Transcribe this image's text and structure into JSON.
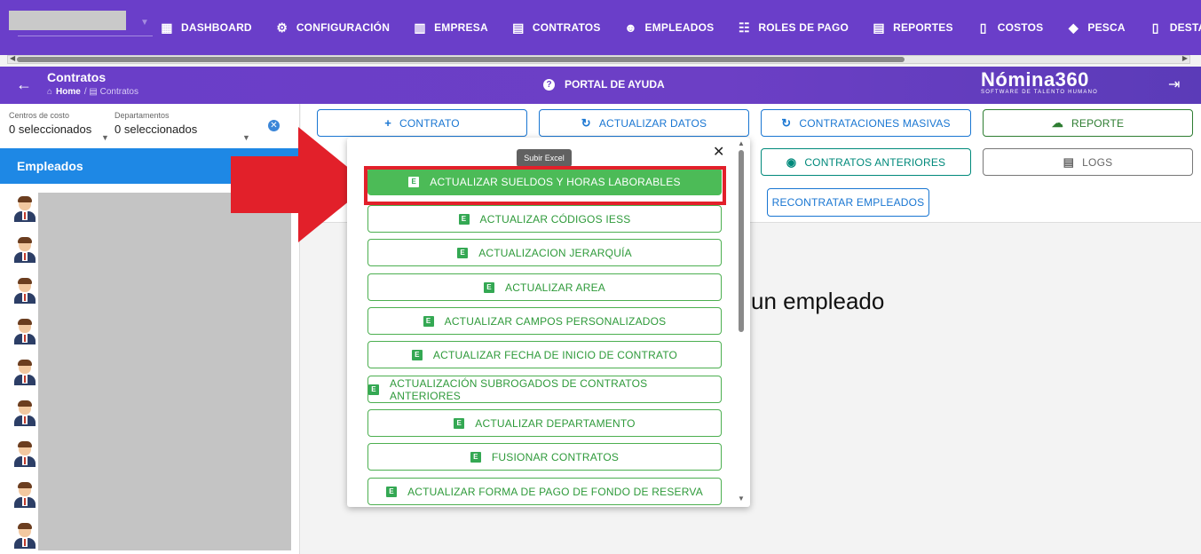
{
  "topnav": {
    "items": [
      {
        "label": "DASHBOARD",
        "icon": "dashboard-icon",
        "glyph": "▦"
      },
      {
        "label": "CONFIGURACIÓN",
        "icon": "gear-icon",
        "glyph": "⚙"
      },
      {
        "label": "EMPRESA",
        "icon": "building-icon",
        "glyph": "▥"
      },
      {
        "label": "CONTRATOS",
        "icon": "clipboard-icon",
        "glyph": "▤"
      },
      {
        "label": "EMPLEADOS",
        "icon": "face-icon",
        "glyph": "☻"
      },
      {
        "label": "ROLES DE PAGO",
        "icon": "group-icon",
        "glyph": "☷"
      },
      {
        "label": "REPORTES",
        "icon": "report-icon",
        "glyph": "▤"
      },
      {
        "label": "COSTOS",
        "icon": "cost-file-icon",
        "glyph": "▯"
      },
      {
        "label": "PESCA",
        "icon": "fish-icon",
        "glyph": "◆"
      },
      {
        "label": "DESTAJO",
        "icon": "document-icon",
        "glyph": "▯"
      }
    ]
  },
  "header": {
    "title": "Contratos",
    "breadcrumb_home": "Home",
    "breadcrumb_current": "Contratos",
    "help_label": "PORTAL DE AYUDA",
    "brand_name": "Nómina360",
    "brand_tagline": "SOFTWARE DE TALENTO HUMANO"
  },
  "filters": {
    "cost_centers_label": "Centros de costo",
    "cost_centers_value": "0 seleccionados",
    "departments_label": "Departamentos",
    "departments_value": "0 seleccionados"
  },
  "employees": {
    "header": "Empleados"
  },
  "toolbar": {
    "contrato": "CONTRATO",
    "actualizar_datos": "ACTUALIZAR DATOS",
    "contrataciones_masivas": "CONTRATACIONES MASIVAS",
    "reporte": "REPORTE",
    "contratos_anteriores": "CONTRATOS ANTERIORES",
    "logs": "LOGS",
    "recontratar": "RECONTRATAR EMPLEADOS"
  },
  "main": {
    "placeholder_text": "un empleado"
  },
  "popup": {
    "tooltip": "Subir Excel",
    "close": "✕",
    "options": [
      "ACTUALIZAR SUELDOS Y HORAS LABORABLES",
      "ACTUALIZAR CÓDIGOS IESS",
      "ACTUALIZACION JERARQUÍA",
      "ACTUALIZAR AREA",
      "ACTUALIZAR CAMPOS PERSONALIZADOS",
      "ACTUALIZAR FECHA DE INICIO DE CONTRATO",
      "ACTUALIZACIÓN SUBROGADOS DE CONTRATOS ANTERIORES",
      "ACTUALIZAR DEPARTAMENTO",
      "FUSIONAR CONTRATOS",
      "ACTUALIZAR FORMA DE PAGO DE FONDO DE RESERVA"
    ],
    "option_icon_letter": "E"
  },
  "colors": {
    "nav_purple": "#6a3ec9",
    "primary_blue": "#1e88e5",
    "excel_green": "#4cbb57",
    "highlight_red": "#e2202a"
  }
}
